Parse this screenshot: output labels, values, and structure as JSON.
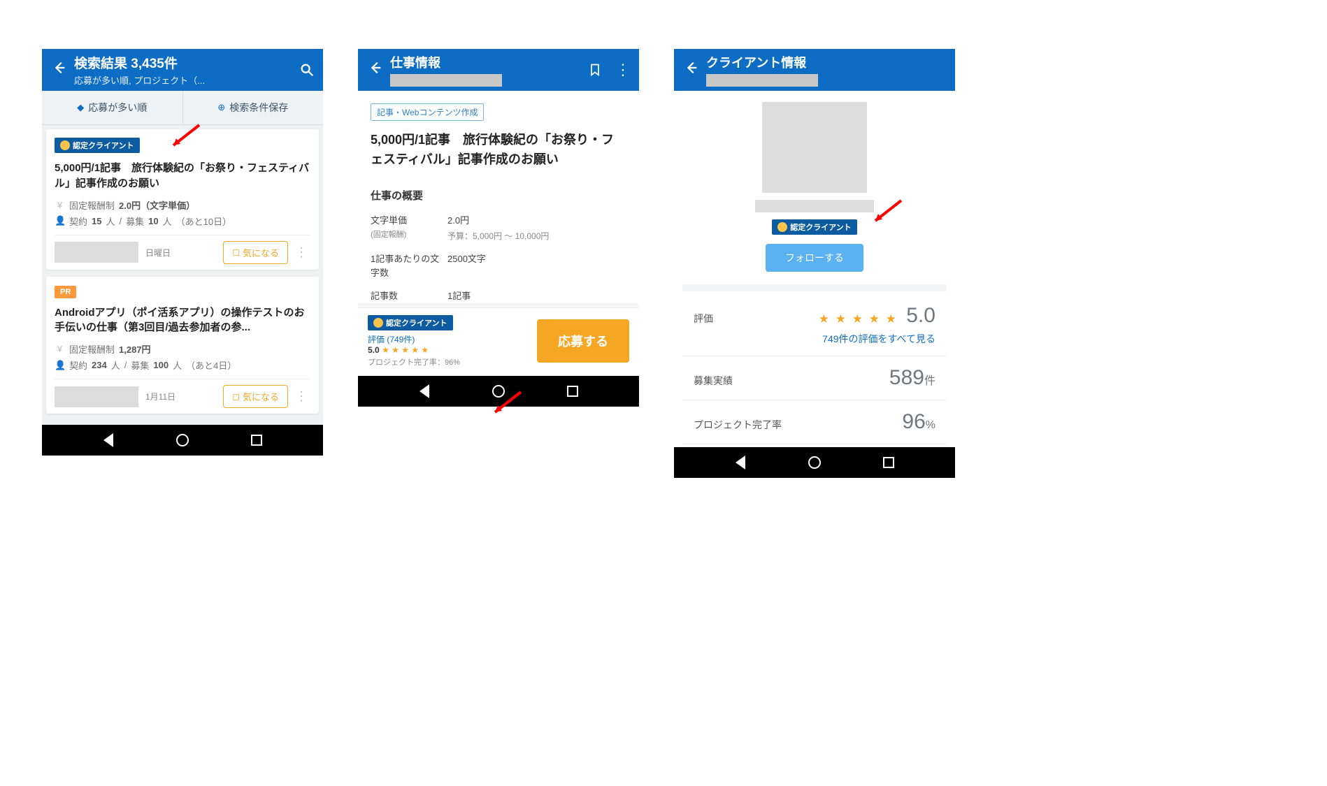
{
  "screen1": {
    "header": {
      "title": "検索結果 3,435件",
      "subtitle": "応募が多い順, プロジェクト（..."
    },
    "toolbar": {
      "sort": "応募が多い順",
      "save": "検索条件保存"
    },
    "card1": {
      "badge": "認定クライアント",
      "title": "5,000円/1記事　旅行体験紀の「お祭り・フェスティバル」記事作成のお願い",
      "price_label": "固定報酬制",
      "price_value": "2.0円（文字単価）",
      "contract": "契約",
      "contract_n": "15",
      "recruit": "募集",
      "recruit_n": "10",
      "people": "人",
      "deadline": "（あと10日）",
      "date": "日曜日",
      "fav": "気になる"
    },
    "card2": {
      "pr_label": "PR",
      "title": "Androidアプリ（ポイ活系アプリ）の操作テストのお手伝いの仕事（第3回目/過去参加者の参...",
      "price_label": "固定報酬制",
      "price_value": "1,287円",
      "contract": "契約",
      "contract_n": "234",
      "recruit": "募集",
      "recruit_n": "100",
      "people": "人",
      "deadline": "（あと4日）",
      "date": "1月11日",
      "fav": "気になる"
    }
  },
  "screen2": {
    "header": {
      "title": "仕事情報"
    },
    "category": "記事・Webコンテンツ作成",
    "job_title": "5,000円/1記事　旅行体験紀の「お祭り・フェスティバル」記事作成のお願い",
    "section": "仕事の概要",
    "spec1": {
      "label": "文字単価",
      "sublabel": "(固定報酬)",
      "value": "2.0円",
      "subvalue": "予算：5,000円 〜 10,000円"
    },
    "spec2": {
      "label": "1記事あたりの文字数",
      "value": "2500文字"
    },
    "spec3": {
      "label": "記事数",
      "value": "1記事"
    },
    "mini": {
      "badge": "認定クライアント",
      "rating_link_prefix": "評価",
      "rating_link": "(749件)",
      "score": "5.0",
      "stars": "★ ★ ★ ★ ★",
      "completion_label": "プロジェクト完了率：",
      "completion_value": "96%"
    },
    "apply": "応募する"
  },
  "screen3": {
    "header": {
      "title": "クライアント情報"
    },
    "badge": "認定クライアント",
    "follow": "フォローする",
    "rating": {
      "label": "評価",
      "stars": "★ ★ ★ ★ ★",
      "score": "5.0",
      "link": "749件の評価をすべて見る"
    },
    "recruited": {
      "label": "募集実績",
      "value": "589",
      "unit": "件"
    },
    "completion": {
      "label": "プロジェクト完了率",
      "value": "96",
      "unit": "%"
    }
  }
}
